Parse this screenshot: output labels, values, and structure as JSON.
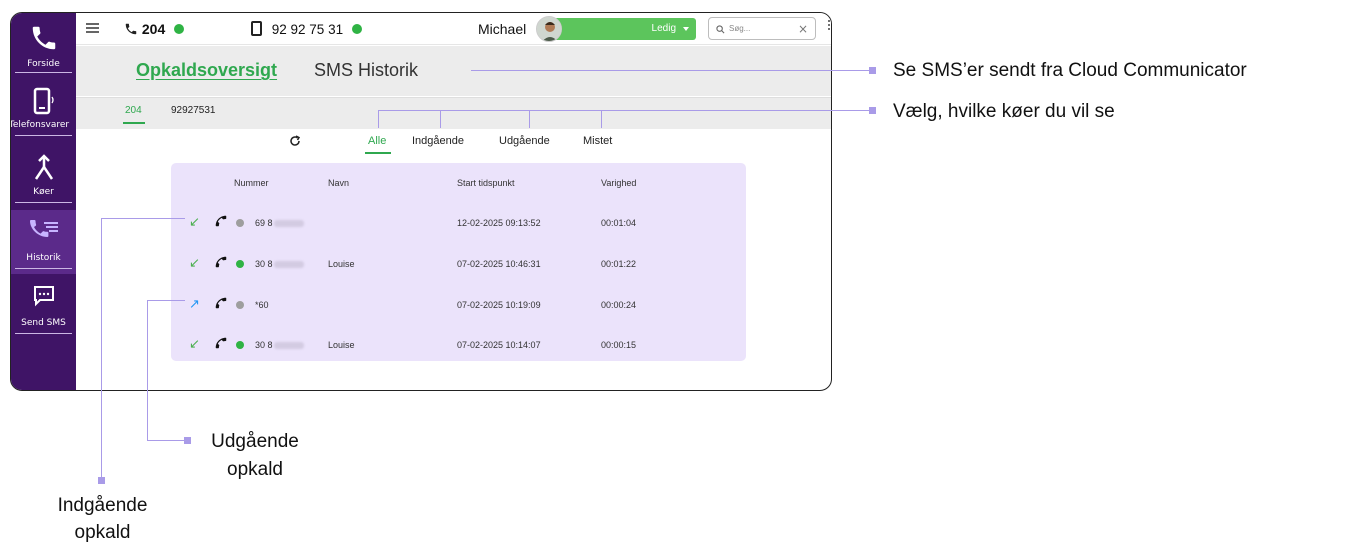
{
  "sidebar": {
    "items": [
      {
        "label": "Forside",
        "icon": "phone-icon"
      },
      {
        "label": "Telefonsvarer",
        "icon": "voicemail-phone-icon"
      },
      {
        "label": "Køer",
        "icon": "merge-arrow-icon"
      },
      {
        "label": "Historik",
        "icon": "call-history-icon"
      },
      {
        "label": "Send SMS",
        "icon": "sms-icon"
      }
    ]
  },
  "topbar": {
    "extension": "204",
    "mobile": "92 92 75 31",
    "user_name": "Michael",
    "status": "Ledig",
    "search_placeholder": "Søg..."
  },
  "tabs": {
    "main": [
      {
        "label": "Opkaldsoversigt",
        "active": true
      },
      {
        "label": "SMS Historik",
        "active": false
      }
    ],
    "queues": [
      {
        "label": "204",
        "active": true
      },
      {
        "label": "92927531",
        "active": false
      }
    ],
    "filters": [
      {
        "label": "Alle",
        "active": true
      },
      {
        "label": "Indgående",
        "active": false
      },
      {
        "label": "Udgående",
        "active": false
      },
      {
        "label": "Mistet",
        "active": false
      }
    ]
  },
  "table": {
    "headers": {
      "number": "Nummer",
      "name": "Navn",
      "start": "Start tidspunkt",
      "duration": "Varighed"
    },
    "rows": [
      {
        "direction": "incoming",
        "status": "gray",
        "number": "69 8",
        "name": "",
        "start": "12-02-2025 09:13:52",
        "duration": "00:01:04"
      },
      {
        "direction": "incoming",
        "status": "green",
        "number": "30 8",
        "name": "Louise",
        "start": "07-02-2025 10:46:31",
        "duration": "00:01:22"
      },
      {
        "direction": "outgoing",
        "status": "gray",
        "number": "*60",
        "name": "",
        "start": "07-02-2025 10:19:09",
        "duration": "00:00:24"
      },
      {
        "direction": "incoming",
        "status": "green",
        "number": "30 8",
        "name": "Louise",
        "start": "07-02-2025 10:14:07",
        "duration": "00:00:15"
      }
    ]
  },
  "annotations": {
    "sms": "Se SMS’er sendt fra Cloud Communicator",
    "queues": "Vælg, hvilke køer du vil se",
    "outgoing_line1": "Udgående",
    "outgoing_line2": "opkald",
    "incoming_line1": "Indgående",
    "incoming_line2": "opkald"
  },
  "colors": {
    "sidebar": "#3f1466",
    "accent_green": "#2fa84f",
    "table_bg": "#ebe3fb",
    "annotation": "#a99be8"
  }
}
